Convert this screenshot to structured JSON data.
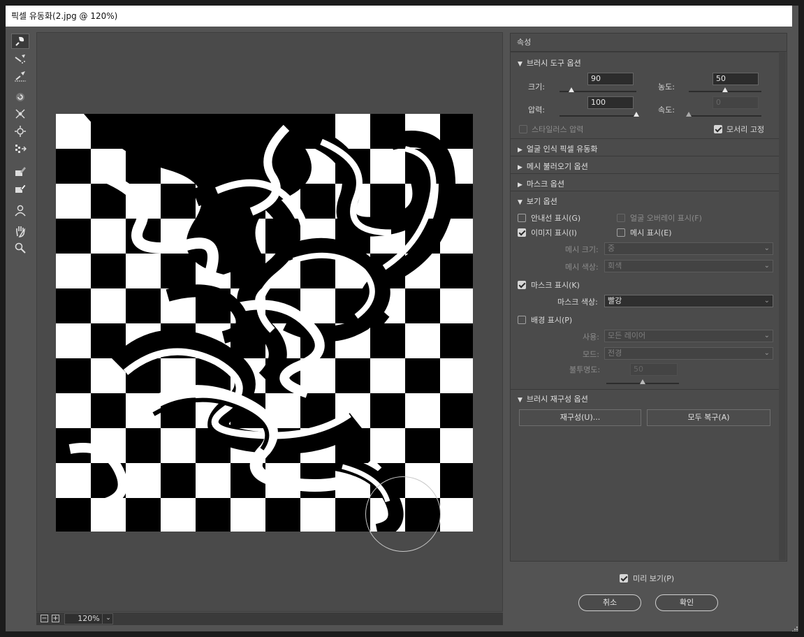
{
  "window": {
    "title": "픽셀 유동화(2.jpg @ 120%)"
  },
  "tools": [
    {
      "name": "forward-warp-tool-icon",
      "active": true
    },
    {
      "name": "reconstruct-tool-icon"
    },
    {
      "name": "smooth-tool-icon"
    },
    {
      "name": "twirl-tool-icon"
    },
    {
      "name": "pucker-tool-icon"
    },
    {
      "name": "bloat-tool-icon"
    },
    {
      "name": "push-left-tool-icon"
    },
    {
      "name": "freeze-mask-tool-icon"
    },
    {
      "name": "thaw-mask-tool-icon"
    },
    {
      "name": "face-tool-icon"
    },
    {
      "name": "hand-tool-icon"
    },
    {
      "name": "zoom-tool-icon"
    }
  ],
  "zoom": {
    "value": "120%"
  },
  "panel": {
    "title": "속성",
    "brush_tool": {
      "header": "브러시 도구 옵션",
      "size_label": "크기:",
      "size_value": "90",
      "size_fraction": 0.15,
      "density_label": "농도:",
      "density_value": "50",
      "density_fraction": 0.5,
      "pressure_label": "압력:",
      "pressure_value": "100",
      "pressure_fraction": 1.0,
      "rate_label": "속도:",
      "rate_value": "0",
      "rate_fraction": 0.0,
      "stylus_label": "스타일러스 압력",
      "stylus_checked": false,
      "pin_edges_label": "모서리 고정",
      "pin_edges_checked": true
    },
    "face_aware": {
      "header": "얼굴 인식 픽셀 유동화"
    },
    "load_mesh": {
      "header": "메시 불러오기 옵션"
    },
    "mask": {
      "header": "마스크 옵션"
    },
    "view": {
      "header": "보기 옵션",
      "show_guides": "안내선 표시(G)",
      "show_face_overlay": "얼굴 오버레이 표시(F)",
      "show_image": "이미지 표시(I)",
      "show_mesh": "메시 표시(E)",
      "mesh_size_label": "메시 크기:",
      "mesh_size_value": "중",
      "mesh_color_label": "메시 색상:",
      "mesh_color_value": "회색",
      "show_mask": "마스크 표시(K)",
      "mask_color_label": "마스크 색상:",
      "mask_color_value": "빨강",
      "show_backdrop": "배경 표시(P)",
      "use_label": "사용:",
      "use_value": "모든 레이어",
      "mode_label": "모드:",
      "mode_value": "전경",
      "opacity_label": "불투명도:",
      "opacity_value": "50",
      "opacity_fraction": 0.5
    },
    "reconstruct": {
      "header": "브러시 재구성 옵션",
      "reconstruct_button": "재구성(U)...",
      "restore_all_button": "모두 복구(A)"
    }
  },
  "footer": {
    "preview_label": "미리 보기(P)",
    "preview_checked": true,
    "cancel_label": "취소",
    "ok_label": "확인"
  },
  "colors": {
    "background": "#535353",
    "panel": "#4b4b4b",
    "canvas": "#4a4a4a"
  }
}
